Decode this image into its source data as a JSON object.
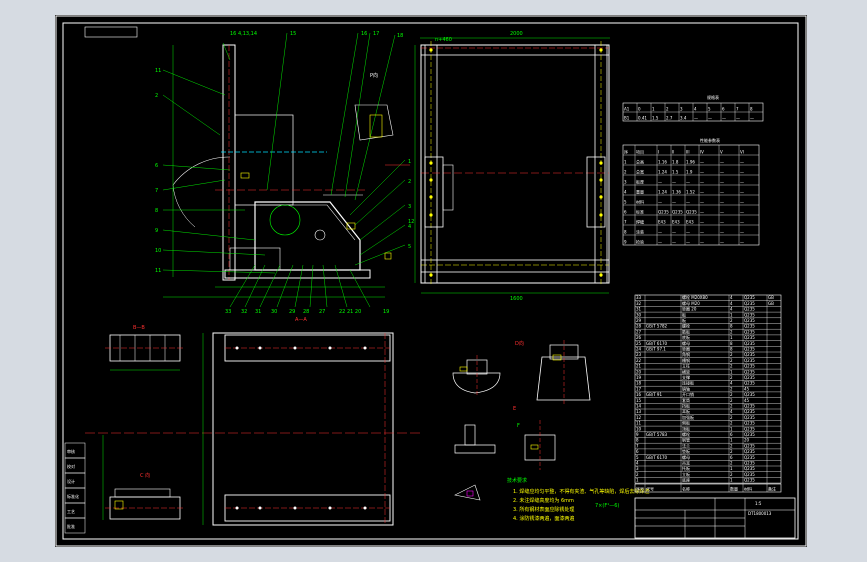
{
  "sheet": {
    "drawing_number": "DT1800013",
    "scale_label": "1:5"
  },
  "front_view": {
    "callouts": [
      "16 4,13,14",
      "15",
      "16",
      "17",
      "18",
      "11",
      "2",
      "P向",
      "1",
      "2",
      "3",
      "4",
      "5",
      "6",
      "7",
      "8",
      "9",
      "10",
      "11",
      "12"
    ],
    "bottom_callouts": [
      "33",
      "32",
      "31",
      "30",
      "29",
      "28",
      "27",
      "26",
      "25",
      "24",
      "23",
      "22 21 20",
      "19"
    ],
    "section_mark": "A—A"
  },
  "side_view": {
    "top_dim": "2000",
    "left_tag": "n+460",
    "bottom_dim": "1600"
  },
  "detail_views": {
    "view_b_title": "B—B",
    "view_c_title": "C 向",
    "view_d_title": "D向",
    "view_e_title": "E",
    "view_f_title": "F"
  },
  "spec_table_1": {
    "title": "规格表",
    "rows": [
      [
        "A1",
        "0",
        "1",
        "2",
        "3",
        "4",
        "5",
        "6",
        "7",
        "8"
      ],
      [
        "B1",
        "0.41",
        "1.5",
        "2.7",
        "3.4",
        "—",
        "—",
        "—",
        "—",
        "—"
      ]
    ]
  },
  "spec_table_2": {
    "title": "性能参数表",
    "rows": [
      [
        "序",
        "项目",
        "I",
        "II",
        "III",
        "IV",
        "V",
        "VI"
      ],
      [
        "1",
        "总高",
        "1.16",
        "1.8",
        "1.96",
        "—",
        "—",
        "—"
      ],
      [
        "2",
        "总宽",
        "1.24",
        "1.5",
        "1.9",
        "—",
        "—",
        "—"
      ],
      [
        "3",
        "板厚",
        "—",
        "—",
        "—",
        "—",
        "—",
        "—"
      ],
      [
        "4",
        "重量",
        "1.24",
        "1.36",
        "1.52",
        "—",
        "—",
        "—"
      ],
      [
        "5",
        "材料",
        "—",
        "—",
        "—",
        "—",
        "—",
        "—"
      ],
      [
        "6",
        "标准",
        "Q235",
        "Q235",
        "Q235",
        "—",
        "—",
        "—"
      ],
      [
        "7",
        "焊缝",
        "E43",
        "E43",
        "E43",
        "—",
        "—",
        "—"
      ],
      [
        "8",
        "涂装",
        "—",
        "—",
        "—",
        "—",
        "—",
        "—"
      ],
      [
        "9",
        "检验",
        "—",
        "—",
        "—",
        "—",
        "—",
        "—"
      ]
    ]
  },
  "parts_list": {
    "header": [
      "序号",
      "代号",
      "名称",
      "数量",
      "材料",
      "备注"
    ],
    "rows": [
      [
        "33",
        "",
        "螺栓 M20X80",
        "4",
        "Q235",
        "GB"
      ],
      [
        "32",
        "",
        "螺母 M20",
        "4",
        "Q235",
        "GB"
      ],
      [
        "31",
        "",
        "垫圈 20",
        "4",
        "Q235",
        ""
      ],
      [
        "30",
        "",
        "板",
        "1",
        "Q235",
        ""
      ],
      [
        "29",
        "",
        "板",
        "2",
        "Q235",
        ""
      ],
      [
        "28",
        "GB/T 5782",
        "螺栓",
        "8",
        "Q235",
        ""
      ],
      [
        "27",
        "",
        "筋板",
        "2",
        "Q235",
        ""
      ],
      [
        "26",
        "",
        "底板",
        "1",
        "Q235",
        ""
      ],
      [
        "25",
        "GB/T 6170",
        "螺母",
        "8",
        "Q235",
        ""
      ],
      [
        "24",
        "GB/T 97.1",
        "垫圈",
        "8",
        "Q235",
        ""
      ],
      [
        "23",
        "",
        "角钢",
        "2",
        "Q235",
        ""
      ],
      [
        "22",
        "",
        "槽钢",
        "2",
        "Q235",
        ""
      ],
      [
        "21",
        "",
        "立柱",
        "2",
        "Q235",
        ""
      ],
      [
        "20",
        "",
        "横梁",
        "1",
        "Q235",
        ""
      ],
      [
        "19",
        "",
        "支撑",
        "2",
        "Q235",
        ""
      ],
      [
        "18",
        "",
        "连接板",
        "4",
        "Q235",
        ""
      ],
      [
        "17",
        "",
        "销轴",
        "2",
        "45",
        ""
      ],
      [
        "16",
        "GB/T 91",
        "开口销",
        "2",
        "Q235",
        ""
      ],
      [
        "15",
        "",
        "套筒",
        "2",
        "45",
        ""
      ],
      [
        "14",
        "",
        "挡板",
        "2",
        "Q235",
        ""
      ],
      [
        "13",
        "",
        "耳板",
        "4",
        "Q235",
        ""
      ],
      [
        "12",
        "",
        "加强板",
        "2",
        "Q235",
        ""
      ],
      [
        "11",
        "",
        "侧板",
        "2",
        "Q235",
        ""
      ],
      [
        "10",
        "",
        "顶板",
        "1",
        "Q235",
        ""
      ],
      [
        "9",
        "GB/T 5783",
        "螺栓",
        "6",
        "Q235",
        ""
      ],
      [
        "8",
        "",
        "钢管",
        "1",
        "20",
        ""
      ],
      [
        "7",
        "",
        "法兰",
        "2",
        "Q235",
        ""
      ],
      [
        "6",
        "",
        "垫板",
        "2",
        "Q235",
        ""
      ],
      [
        "5",
        "GB/T 6170",
        "螺母",
        "6",
        "Q235",
        ""
      ],
      [
        "4",
        "",
        "吊耳",
        "2",
        "Q235",
        ""
      ],
      [
        "3",
        "",
        "托板",
        "1",
        "Q235",
        ""
      ],
      [
        "2",
        "",
        "立板",
        "2",
        "Q235",
        ""
      ],
      [
        "1",
        "",
        "底座",
        "1",
        "Q235",
        ""
      ]
    ]
  },
  "tech_notes": {
    "title": "技术要求",
    "lines": [
      "1. 焊缝应均匀平整，不得有夹渣、气孔等缺陷，焊后去除焊渣",
      "2. 未注焊缝高度均为 6mm",
      "3. 所有钢材表面应除锈处理",
      "4. 涂防锈漆两遍，面漆两遍"
    ],
    "formula": "7×(F¹—6)"
  },
  "title_block": {
    "drawing_number": "DT1800013",
    "left_strip": [
      "审核",
      "校对",
      "设计",
      "标准化",
      "工艺",
      "批准"
    ]
  }
}
